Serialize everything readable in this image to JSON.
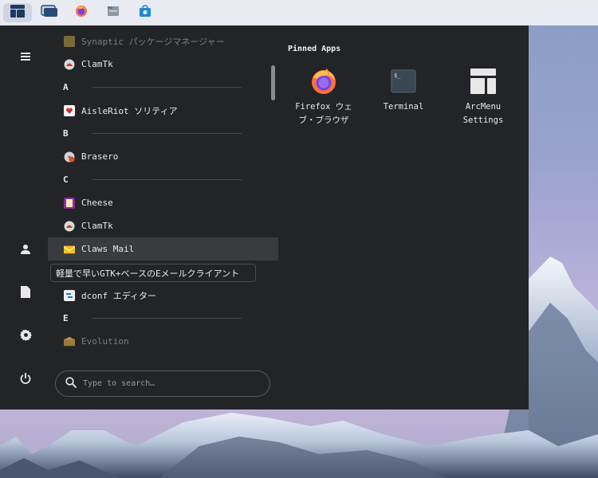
{
  "taskbar": {
    "items": [
      {
        "icon": "arc-menu-icon",
        "active": true
      },
      {
        "icon": "overview-icon",
        "active": false
      },
      {
        "icon": "firefox-icon",
        "active": false
      },
      {
        "icon": "files-icon",
        "active": false
      },
      {
        "icon": "software-store-icon",
        "active": false
      }
    ]
  },
  "sidebar": {
    "buttons": [
      {
        "icon": "hamburger-icon"
      },
      {
        "icon": "user-icon"
      },
      {
        "icon": "documents-icon"
      },
      {
        "icon": "settings-icon"
      },
      {
        "icon": "power-icon"
      }
    ]
  },
  "app_list": {
    "items": [
      {
        "type": "app",
        "label": "Synaptic パッケージマネージャー",
        "icon": "synaptic-icon",
        "dim": true
      },
      {
        "type": "app",
        "label": "ClamTk",
        "icon": "clamtk-icon"
      },
      {
        "type": "category",
        "label": "A"
      },
      {
        "type": "app",
        "label": "AisleRiot ソリティア",
        "icon": "aisleriot-icon"
      },
      {
        "type": "category",
        "label": "B"
      },
      {
        "type": "app",
        "label": "Brasero",
        "icon": "brasero-icon"
      },
      {
        "type": "category",
        "label": "C"
      },
      {
        "type": "app",
        "label": "Cheese",
        "icon": "cheese-icon"
      },
      {
        "type": "app",
        "label": "ClamTk",
        "icon": "clamtk-icon"
      },
      {
        "type": "app",
        "label": "Claws Mail",
        "icon": "claws-mail-icon",
        "hover": true
      },
      {
        "type": "app",
        "label": "",
        "icon": "hidden"
      },
      {
        "type": "app",
        "label": "dconf エディター",
        "icon": "dconf-icon"
      },
      {
        "type": "category",
        "label": "E"
      },
      {
        "type": "app",
        "label": "Evolution",
        "icon": "evolution-icon",
        "dim": true
      }
    ],
    "tooltip": "軽量で早いGTK+ベースのEメールクライアント"
  },
  "search": {
    "placeholder": "Type to search…"
  },
  "pinned": {
    "title": "Pinned Apps",
    "apps": [
      {
        "label": "Firefox ウェブ・ブラウザ",
        "icon": "firefox-icon"
      },
      {
        "label": "Terminal",
        "icon": "terminal-icon"
      },
      {
        "label": "ArcMenu Settings",
        "icon": "arcmenu-settings-icon"
      }
    ]
  },
  "colors": {
    "menu_bg": "#232427",
    "panel_bg": "#e9ebf2",
    "accent_blue": "#1a5fb4",
    "firefox_orange": "#ff7139"
  }
}
